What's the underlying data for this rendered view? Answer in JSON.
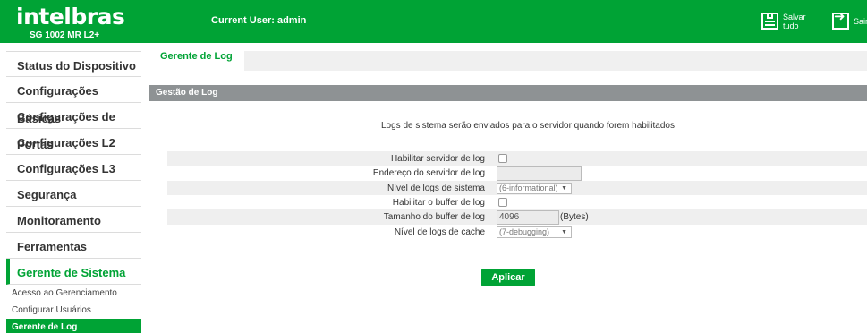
{
  "header": {
    "logo": "intelbras",
    "model": "SG 1002 MR L2+",
    "current_user": "Current User: admin",
    "save_label_1": "Salvar",
    "save_label_2": "tudo",
    "exit_label": "Sair"
  },
  "sidebar": {
    "items": [
      "Status do Dispositivo",
      "Configurações Básicas",
      "Configurações de Portas",
      "Configurações L2",
      "Configurações L3",
      "Segurança",
      "Monitoramento",
      "Ferramentas",
      "Gerente de Sistema"
    ],
    "subitems": [
      "Acesso ao Gerenciamento",
      "Configurar Usuários",
      "Gerente de Log"
    ]
  },
  "tab": {
    "label": "Gerente de Log"
  },
  "section": {
    "title": "Gestão de Log"
  },
  "info_text": "Logs de sistema serão enviados para o servidor quando forem habilitados",
  "form": {
    "enable_server_label": "Habilitar servidor de log",
    "server_address_label": "Endereço do servidor de log",
    "server_address_value": "",
    "system_level_label": "Nível de logs de sistema",
    "system_level_value": "(6-informational)",
    "enable_buffer_label": "Habilitar o buffer de log",
    "buffer_size_label": "Tamanho do buffer de log",
    "buffer_size_value": "4096",
    "buffer_size_unit": "(Bytes)",
    "cache_level_label": "Nível de logs de cache",
    "cache_level_value": "(7-debugging)"
  },
  "apply_label": "Aplicar",
  "colors": {
    "brand": "#00a335",
    "section": "#8e9294"
  }
}
